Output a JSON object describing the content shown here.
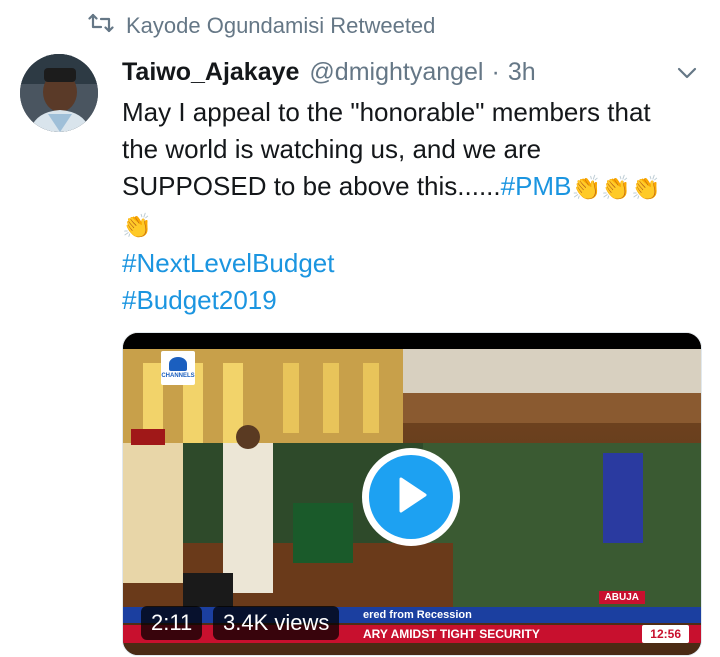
{
  "retweet": {
    "text": "Kayode Ogundamisi Retweeted"
  },
  "tweet": {
    "display_name": "Taiwo_Ajakaye",
    "handle": "@dmightyangel",
    "separator": "·",
    "time": "3h",
    "text_lines": [
      "May I appeal to the \"honorable\" members that",
      "the world is watching us, and we are",
      "SUPPOSED to be above this......"
    ],
    "hashtags": [
      "#PMB",
      "#NextLevelBudget",
      "#Budget2019"
    ],
    "clap_emoji": "👏"
  },
  "video": {
    "duration": "2:11",
    "views": "3.4K views",
    "channel_logo": "CHANNELS",
    "location": "ABUJA",
    "ticker_top": "ered from Recession",
    "ticker_bottom": "ARY AMIDST TIGHT SECURITY",
    "ticker_time": "12:56"
  },
  "icons": {
    "retweet": "retweet-icon",
    "caret": "chevron-down-icon",
    "play": "play-icon"
  },
  "colors": {
    "link": "#1b95e0",
    "play": "#1da1f2",
    "muted": "#657786"
  }
}
